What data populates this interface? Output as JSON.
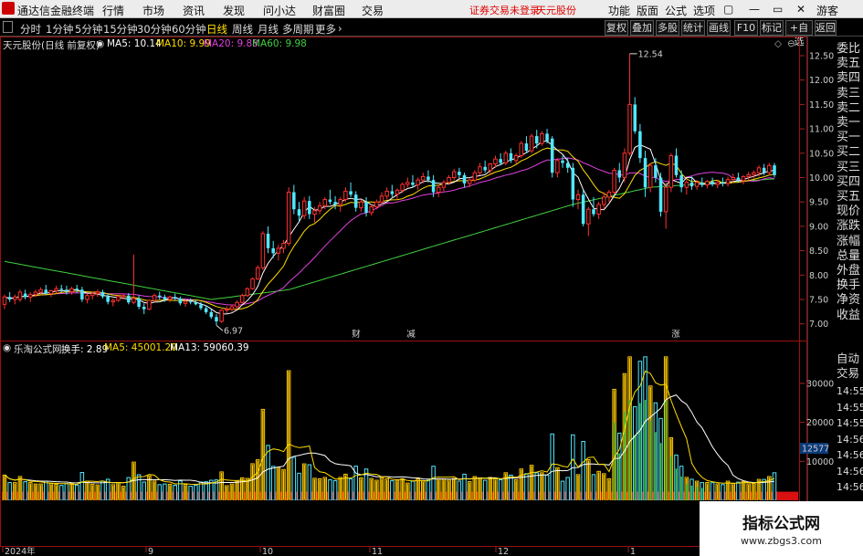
{
  "menu": {
    "app_name": "通达信金融终端",
    "items": [
      "行情",
      "市场",
      "资讯",
      "发现",
      "问小达",
      "财富圈",
      "交易"
    ],
    "notice": "证券交易未登录",
    "stock_name": "天元股份",
    "right_items": [
      "功能",
      "版面",
      "公式",
      "选项"
    ],
    "guest": "游客"
  },
  "toolbar": {
    "periods": [
      "分时",
      "1分钟",
      "5分钟",
      "15分钟",
      "30分钟",
      "60分钟",
      "日线",
      "周线",
      "月线",
      "多周期",
      "更多"
    ],
    "active_period": "日线",
    "right_buttons": [
      "复权",
      "叠加",
      "多股",
      "统计",
      "画线",
      "F10",
      "标记",
      "+自选",
      "返回"
    ]
  },
  "main_chart": {
    "title": "天元股份(日线 前复权)",
    "ma": [
      {
        "label": "MA5: 10.14",
        "color": "#ffffff"
      },
      {
        "label": "MA10: 9.99",
        "color": "#ffdd00"
      },
      {
        "label": "MA20: 9.88",
        "color": "#e040e0"
      },
      {
        "label": "MA60: 9.98",
        "color": "#40d040"
      }
    ],
    "y_ticks": [
      "12.50",
      "12.00",
      "11.50",
      "11.00",
      "10.50",
      "10.00",
      "9.50",
      "9.00",
      "8.50",
      "8.00",
      "7.50",
      "7.00"
    ],
    "high_marker": "12.54",
    "low_marker": "6.97",
    "event_marks": [
      {
        "label": "财",
        "color": "#4080ff"
      },
      {
        "label": "减",
        "color": "#40d040"
      },
      {
        "label": "涨",
        "color": "#ff3030"
      }
    ]
  },
  "volume_chart": {
    "title": "乐淘公式网",
    "turnover_label": "换手: 2.89",
    "ma5": "MA5: 45001.20",
    "ma13": "MA13: 59060.39",
    "y_ticks": [
      "30000",
      "20000",
      "10000"
    ],
    "current_value": "12577"
  },
  "x_axis": [
    "2024年",
    "9",
    "10",
    "11",
    "12",
    "1"
  ],
  "sidebar": {
    "top": [
      "委比",
      "卖五",
      "卖四",
      "卖三",
      "卖二",
      "卖一",
      "买一",
      "买二",
      "买三",
      "买四",
      "买五",
      "现价",
      "涨跌",
      "涨幅",
      "总量",
      "外盘",
      "换手",
      "净资",
      "收益"
    ],
    "auto_trade": [
      "自动",
      "交易"
    ],
    "times": [
      "14:55",
      "14:55",
      "14:55",
      "14:56",
      "14:56",
      "14:56",
      "14:56"
    ]
  },
  "watermark": {
    "title": "指标公式网",
    "url": "www.zbgs3.com"
  },
  "colors": {
    "up": "#ff3030",
    "down": "#50e8ff",
    "ma5": "#ffffff",
    "ma10": "#ffdd00",
    "ma20": "#e040e0",
    "ma60": "#40d040",
    "frame": "#9a1010"
  }
}
